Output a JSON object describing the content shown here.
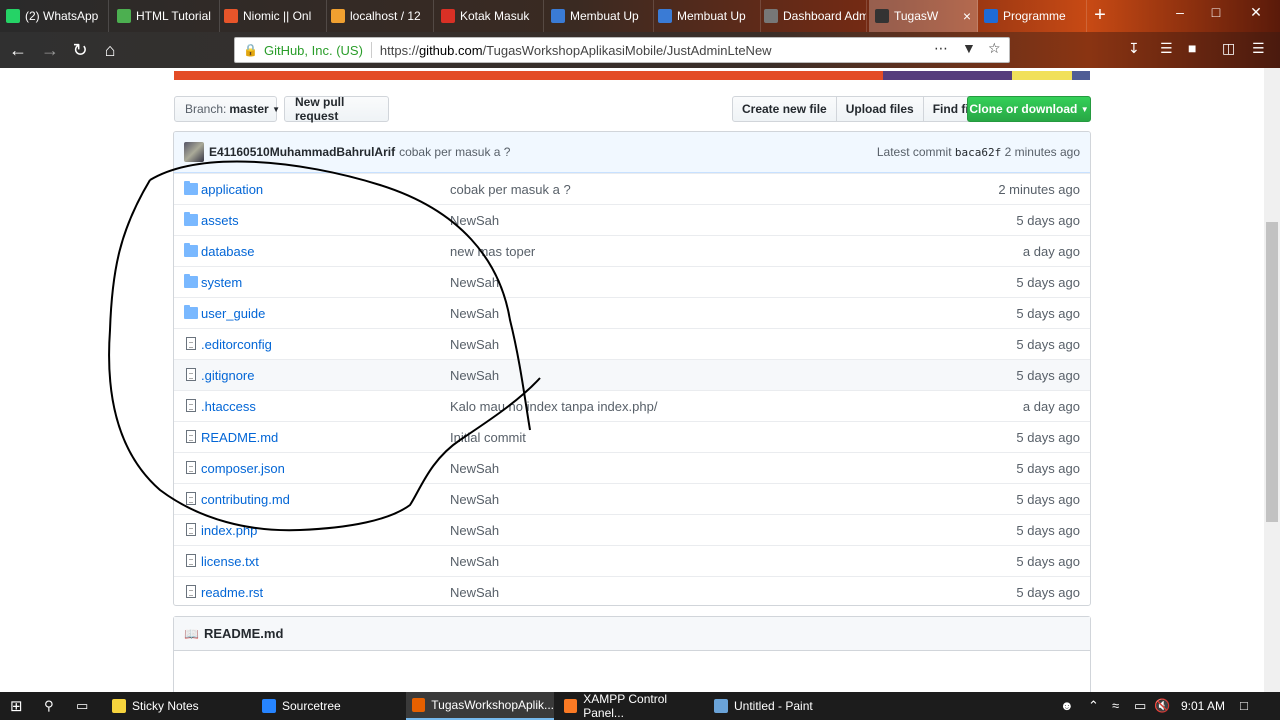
{
  "browser": {
    "tabs": [
      {
        "label": "(2) WhatsApp",
        "icon": "whatsapp-icon",
        "color": "#25d366"
      },
      {
        "label": "HTML Tutorial",
        "icon": "w3schools-icon",
        "color": "#4caf50"
      },
      {
        "label": "Niomic || Onl",
        "icon": "niomic-icon",
        "color": "#e8552a"
      },
      {
        "label": "localhost / 12",
        "icon": "phpmyadmin-icon",
        "color": "#f0a030"
      },
      {
        "label": "Kotak Masuk",
        "icon": "gmail-icon",
        "color": "#d93025"
      },
      {
        "label": "Membuat Up",
        "icon": "edge-icon",
        "color": "#3a7bd5"
      },
      {
        "label": "Membuat Up",
        "icon": "edge-icon",
        "color": "#3a7bd5"
      },
      {
        "label": "Dashboard Admin",
        "icon": "blank-icon",
        "color": "#777777"
      },
      {
        "label": "TugasW",
        "icon": "github-icon",
        "color": "#333333",
        "active": true
      },
      {
        "label": "Programme",
        "icon": "k-icon",
        "color": "#1e6bd6"
      }
    ],
    "security_org": "GitHub, Inc. (US)",
    "url_prefix": "https://",
    "url_host": "github.com",
    "url_path": "/TugasWorkshopAplikasiMobile/JustAdminLteNew"
  },
  "repo": {
    "branch_label": "Branch:",
    "branch_value": "master",
    "new_pr": "New pull request",
    "create_file": "Create new file",
    "upload_files": "Upload files",
    "find_file": "Find file",
    "clone": "Clone or download"
  },
  "commit": {
    "author": "E41160510MuhammadBahrulArif",
    "message": "cobak per masuk a ?",
    "latest_label": "Latest commit",
    "sha": "baca62f",
    "age": "2 minutes ago"
  },
  "files": [
    {
      "name": "application",
      "type": "folder",
      "msg": "cobak per masuk a ?",
      "age": "2 minutes ago"
    },
    {
      "name": "assets",
      "type": "folder",
      "msg": "NewSah",
      "age": "5 days ago"
    },
    {
      "name": "database",
      "type": "folder",
      "msg": "new mas toper",
      "age": "a day ago"
    },
    {
      "name": "system",
      "type": "folder",
      "msg": "NewSah",
      "age": "5 days ago"
    },
    {
      "name": "user_guide",
      "type": "folder",
      "msg": "NewSah",
      "age": "5 days ago"
    },
    {
      "name": ".editorconfig",
      "type": "file",
      "msg": "NewSah",
      "age": "5 days ago"
    },
    {
      "name": ".gitignore",
      "type": "file",
      "msg": "NewSah",
      "age": "5 days ago"
    },
    {
      "name": ".htaccess",
      "type": "file",
      "msg": "Kalo mau no index tanpa index.php/",
      "age": "a day ago"
    },
    {
      "name": "README.md",
      "type": "file",
      "msg": "Initial commit",
      "age": "5 days ago"
    },
    {
      "name": "composer.json",
      "type": "file",
      "msg": "NewSah",
      "age": "5 days ago"
    },
    {
      "name": "contributing.md",
      "type": "file",
      "msg": "NewSah",
      "age": "5 days ago"
    },
    {
      "name": "index.php",
      "type": "file",
      "msg": "NewSah",
      "age": "5 days ago"
    },
    {
      "name": "license.txt",
      "type": "file",
      "msg": "NewSah",
      "age": "5 days ago"
    },
    {
      "name": "readme.rst",
      "type": "file",
      "msg": "NewSah",
      "age": "5 days ago"
    }
  ],
  "readme": {
    "title": "README.md"
  },
  "taskbar": {
    "items": [
      {
        "label": "Sticky Notes",
        "color": "#f5d33d"
      },
      {
        "label": "Sourcetree",
        "color": "#2684ff"
      },
      {
        "label": "TugasWorkshopAplik...",
        "color": "#e66000",
        "active": true
      },
      {
        "label": "XAMPP Control Panel...",
        "color": "#fb7a24"
      },
      {
        "label": "Untitled - Paint",
        "color": "#6aa3d8"
      }
    ],
    "time": "9:01 AM"
  },
  "colors": {
    "link": "#0366d6",
    "green_button": "#28a745",
    "language_bar": [
      "#e34c26",
      "#563d7c",
      "#f1e05a",
      "#4f5d95"
    ]
  }
}
